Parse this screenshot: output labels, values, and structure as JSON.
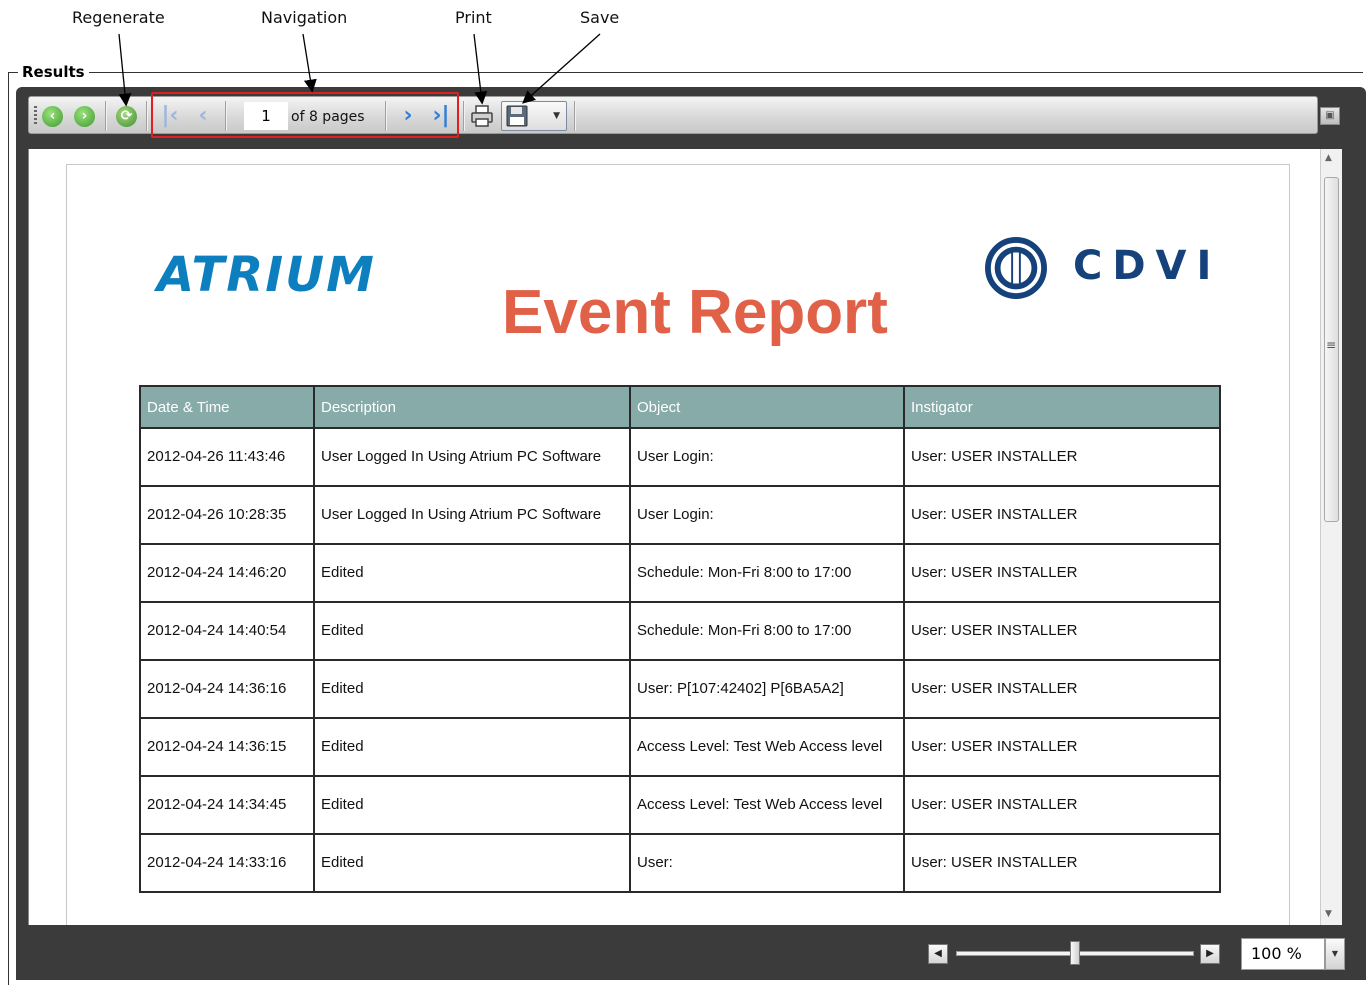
{
  "callouts": {
    "regenerate": "Regenerate",
    "navigation": "Navigation",
    "print": "Print",
    "save": "Save"
  },
  "group": {
    "title": "Results"
  },
  "toolbar": {
    "back_icon": "arrow-left-circle-icon",
    "forward_icon": "arrow-right-circle-icon",
    "refresh_icon": "refresh-icon",
    "current_page": "1",
    "page_of_label": "of 8 pages",
    "print_icon": "printer-icon",
    "save_icon": "floppy-disk-icon"
  },
  "report": {
    "logo_left": "ATRIUM",
    "logo_right": "CDVI",
    "title": "Event Report",
    "columns": [
      "Date & Time",
      "Description",
      "Object",
      "Instigator"
    ],
    "rows": [
      [
        "2012-04-26 11:43:46",
        "User Logged In Using Atrium PC Software",
        "User Login:",
        "User: USER INSTALLER"
      ],
      [
        "2012-04-26 10:28:35",
        "User Logged In Using Atrium PC Software",
        "User Login:",
        "User: USER INSTALLER"
      ],
      [
        "2012-04-24 14:46:20",
        "Edited",
        "Schedule: Mon-Fri 8:00 to 17:00",
        "User: USER INSTALLER"
      ],
      [
        "2012-04-24 14:40:54",
        "Edited",
        "Schedule: Mon-Fri 8:00 to 17:00",
        "User: USER INSTALLER"
      ],
      [
        "2012-04-24 14:36:16",
        "Edited",
        "User: P[107:42402] P[6BA5A2]",
        "User: USER INSTALLER"
      ],
      [
        "2012-04-24 14:36:15",
        "Edited",
        "Access Level: Test Web Access level",
        "User: USER INSTALLER"
      ],
      [
        "2012-04-24 14:34:45",
        "Edited",
        "Access Level: Test Web Access level",
        "User: USER INSTALLER"
      ],
      [
        "2012-04-24 14:33:16",
        "Edited",
        "User:",
        "User: USER INSTALLER"
      ]
    ]
  },
  "zoom": {
    "value": "100 %",
    "slider_fraction": 0.5
  },
  "colors": {
    "header_fill": "#86aba9",
    "title_red": "#e06048",
    "nav_highlight": "#e02020",
    "atrium_blue": "#0d7fbf",
    "cdvi_navy": "#16427b"
  }
}
